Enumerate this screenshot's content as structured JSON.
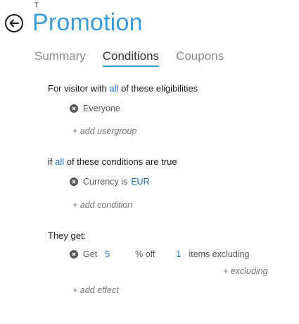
{
  "header": {
    "tiny_mark": "T",
    "title": "Promotion"
  },
  "tabs": [
    {
      "label": "Summary",
      "active": false
    },
    {
      "label": "Conditions",
      "active": true
    },
    {
      "label": "Coupons",
      "active": false
    }
  ],
  "eligibility": {
    "prefix": "For visitor with",
    "quantifier": "all",
    "suffix": "of these eligibilities",
    "items": [
      "Everyone"
    ],
    "add_label": "+ add usergroup"
  },
  "conditions": {
    "prefix": "if",
    "quantifier": "all",
    "suffix": "of these conditions are true",
    "item": {
      "label": "Currency is",
      "value": "EUR"
    },
    "add_label": "+ add condition"
  },
  "effects": {
    "title": "They get:",
    "item": {
      "get_label": "Get",
      "amount": "5",
      "unit_label": "% off",
      "count": "1",
      "items_label": "items excluding"
    },
    "excluding_label": "+ excluding",
    "add_label": "+ add effect"
  },
  "colors": {
    "accent": "#3a9bd9",
    "link": "#1f70b5"
  }
}
